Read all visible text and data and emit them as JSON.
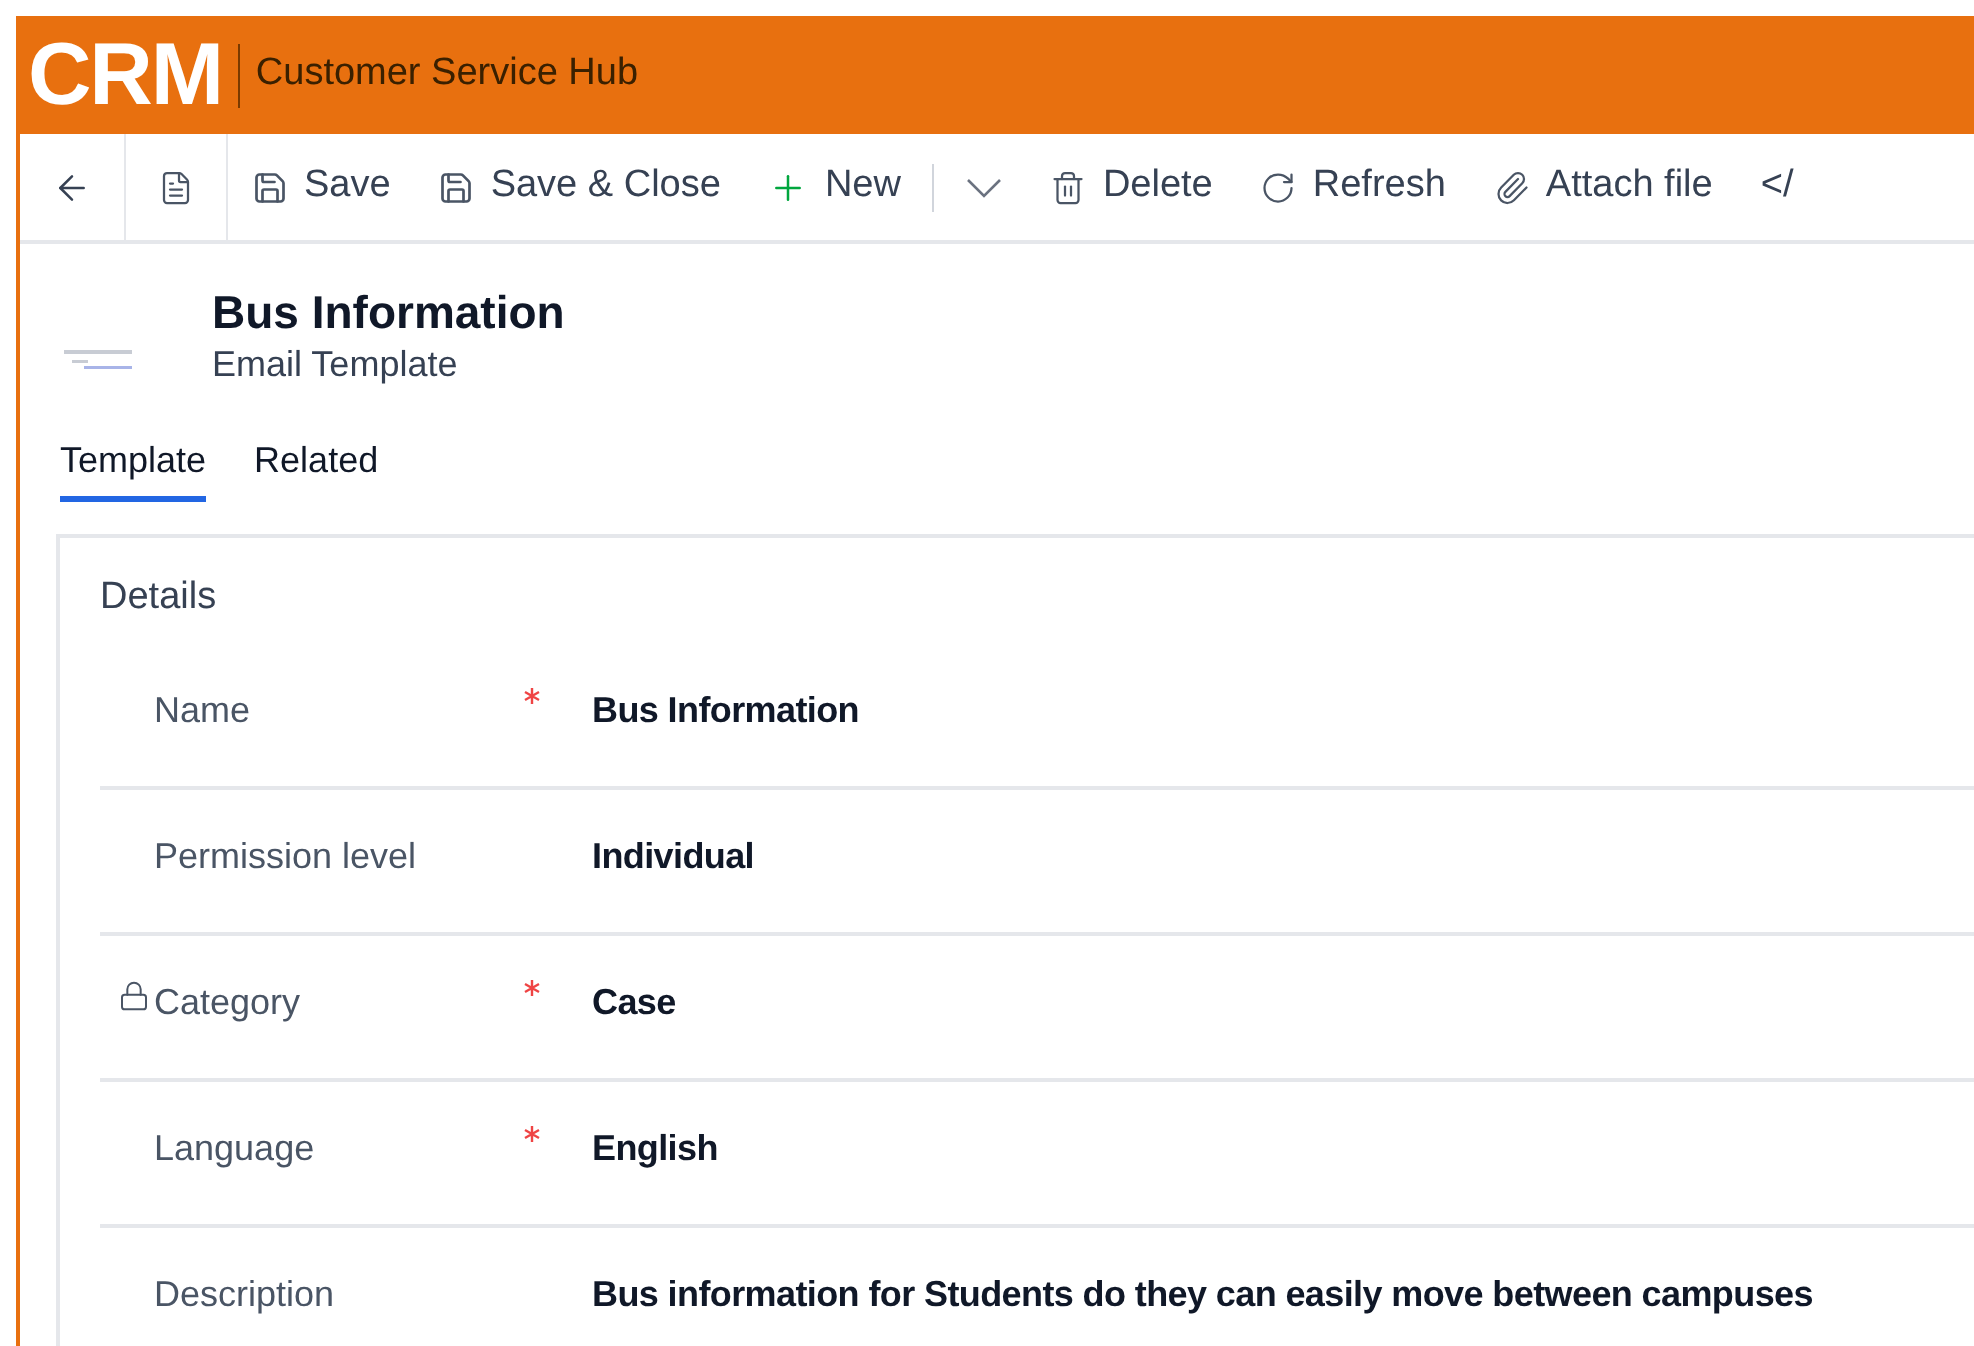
{
  "header": {
    "logo": "CRM",
    "app_name": "Customer Service Hub"
  },
  "toolbar": {
    "items": [
      {
        "kind": "back"
      },
      {
        "kind": "form"
      },
      {
        "kind": "save",
        "label": "Save"
      },
      {
        "kind": "save_close",
        "label": "Save & Close"
      },
      {
        "kind": "new",
        "label": "New"
      },
      {
        "kind": "dropdown"
      },
      {
        "kind": "delete",
        "label": "Delete"
      },
      {
        "kind": "refresh",
        "label": "Refresh"
      },
      {
        "kind": "attach",
        "label": "Attach file"
      },
      {
        "kind": "code",
        "label": "</"
      }
    ]
  },
  "record": {
    "title": "Bus Information",
    "entity": "Email Template"
  },
  "tabs": [
    {
      "label": "Template",
      "selected": true
    },
    {
      "label": "Related",
      "selected": false
    }
  ],
  "section": {
    "title": "Details",
    "fields": [
      {
        "label": "Name",
        "required": true,
        "locked": false,
        "value": "Bus Information"
      },
      {
        "label": "Permission level",
        "required": false,
        "locked": false,
        "value": "Individual"
      },
      {
        "label": "Category",
        "required": true,
        "locked": true,
        "value": "Case"
      },
      {
        "label": "Language",
        "required": true,
        "locked": false,
        "value": "English"
      },
      {
        "label": "Description",
        "required": false,
        "locked": false,
        "value": "Bus information for Students do they can easily move between campuses"
      }
    ]
  }
}
